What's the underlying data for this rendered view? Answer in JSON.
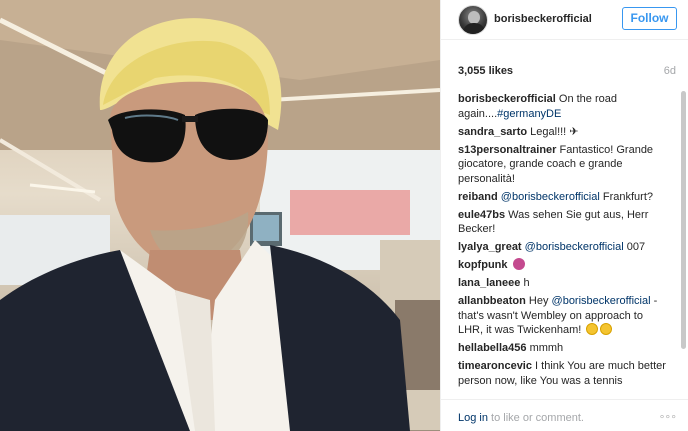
{
  "header": {
    "username": "borisbeckerofficial",
    "follow_label": "Follow"
  },
  "stats": {
    "likes": "3,055 likes",
    "age": "6d"
  },
  "comments": [
    {
      "user": "borisbeckerofficial",
      "text": "On the road again....",
      "mention": "#germanyDE",
      "after": ""
    },
    {
      "user": "sandra_sarto",
      "text": "Legal!!! ✈",
      "mention": "",
      "after": ""
    },
    {
      "user": "s13personaltrainer",
      "text": "Fantastico! Grande giocatore, grande coach e grande personalità!",
      "mention": "",
      "after": ""
    },
    {
      "user": "reiband",
      "text": "",
      "mention": "@borisbeckerofficial",
      "after": " Frankfurt?"
    },
    {
      "user": "eule47bs",
      "text": "Was sehen Sie gut aus, Herr Becker!",
      "mention": "",
      "after": ""
    },
    {
      "user": "lyalya_great",
      "text": "",
      "mention": "@borisbeckerofficial",
      "after": " 007"
    },
    {
      "user": "kopfpunk",
      "text": "",
      "mention": "",
      "after": "",
      "emoji": "devil-emoji"
    },
    {
      "user": "lana_laneee",
      "text": "h",
      "mention": "",
      "after": ""
    },
    {
      "user": "allanbbeaton",
      "text": "Hey ",
      "mention": "@borisbeckerofficial",
      "after": " - that's wasn't Wembley on approach to LHR, it was Twickenham!",
      "emoji2": "smile-emoji"
    },
    {
      "user": "hellabella456",
      "text": "mmmh",
      "mention": "",
      "after": ""
    },
    {
      "user": "timearoncevic",
      "text": "I think You are much better person now, like You was a tennis",
      "mention": "",
      "after": ""
    }
  ],
  "footer": {
    "login_link": "Log in",
    "login_rest": " to like or comment.",
    "more": "°°°"
  },
  "colors": {
    "accent": "#3897f0",
    "mention": "#003569",
    "muted": "#a5a7aa"
  }
}
